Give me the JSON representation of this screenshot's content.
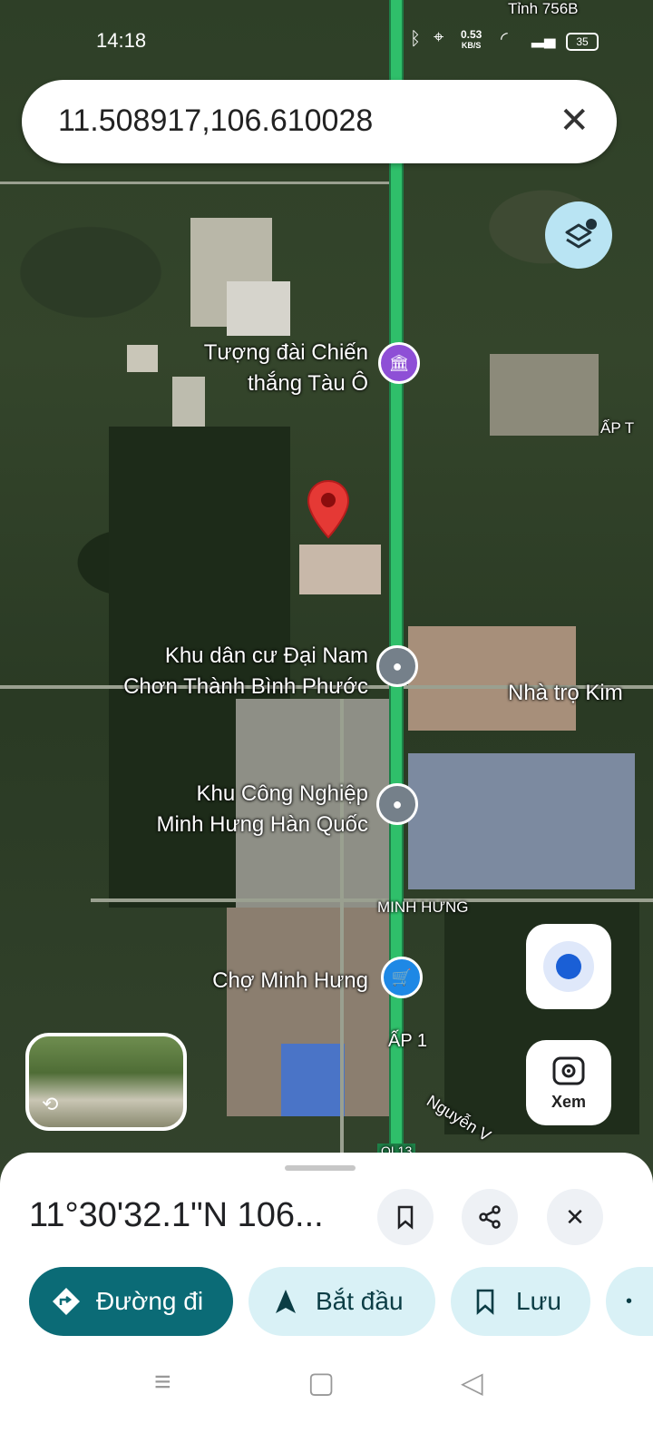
{
  "status_bar": {
    "time": "14:18",
    "net_speed": "0.53",
    "net_unit": "KB/S",
    "battery": "35"
  },
  "search": {
    "value": "11.508917,106.610028",
    "clear_icon": "close-icon"
  },
  "map": {
    "labels": {
      "top_road": "Tỉnh 756B",
      "ap": "ẤP T",
      "poi1_l1": "Tượng đài Chiến",
      "poi1_l2": "thắng Tàu Ô",
      "poi2_l1": "Khu dân cư Đại Nam",
      "poi2_l2": "Chơn Thành Bình Phước",
      "poi3_right": "Nhà trọ Kim",
      "poi4_l1": "Khu Công Nghiệp",
      "poi4_l2": "Minh Hưng Hàn Quốc",
      "area": "MINH HƯNG",
      "poi5": "Chợ Minh Hưng",
      "ap1": "ẤP 1",
      "road2": "Nguyễn V",
      "route": "QL13"
    },
    "pin_color": "#e53935",
    "xem_label": "Xem"
  },
  "sheet": {
    "coord": "11°30'32.1\"N 106...",
    "directions": "Đường đi",
    "start": "Bắt đầu",
    "save": "Lưu"
  },
  "colors": {
    "accent": "#0b6b76",
    "chip_bg": "#d9f1f6",
    "highway": "#2fbf6a"
  }
}
